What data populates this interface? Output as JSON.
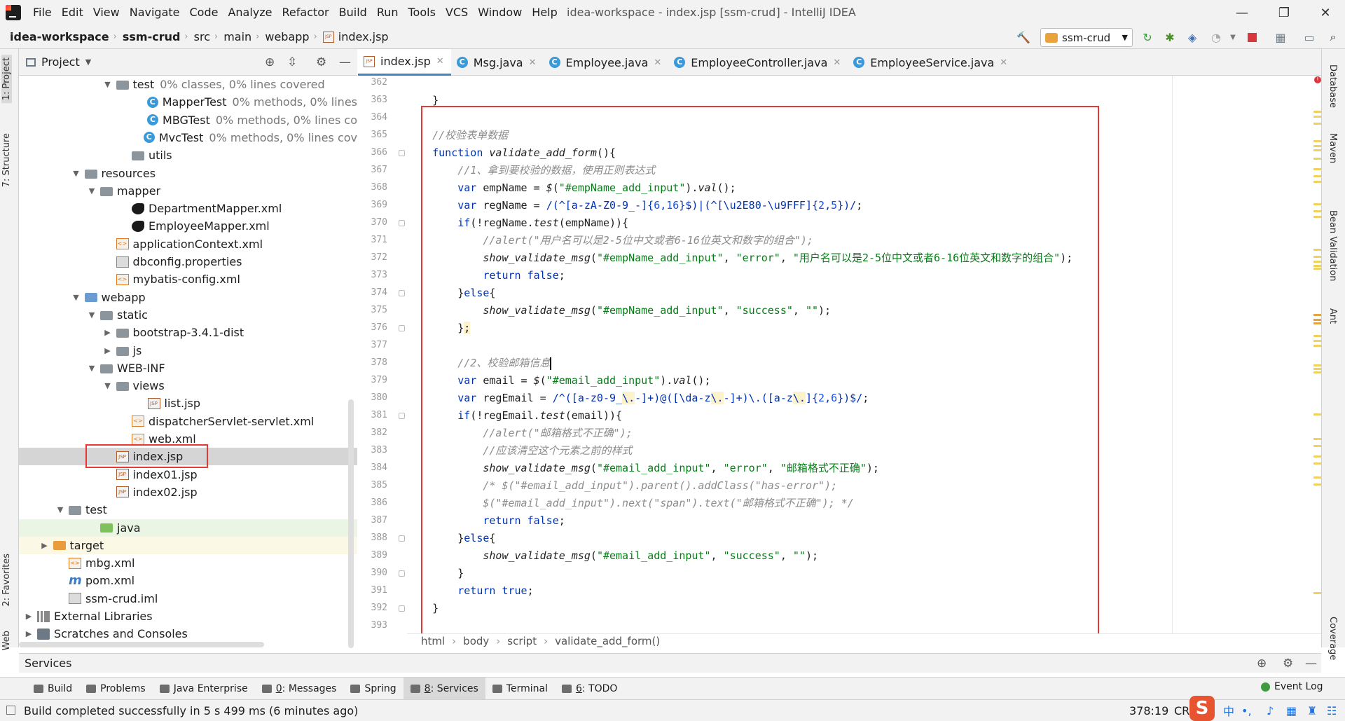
{
  "menu": [
    "File",
    "Edit",
    "View",
    "Navigate",
    "Code",
    "Analyze",
    "Refactor",
    "Build",
    "Run",
    "Tools",
    "VCS",
    "Window",
    "Help"
  ],
  "window_title": "idea-workspace - index.jsp [ssm-crud] - IntelliJ IDEA",
  "breadcrumb": [
    "idea-workspace",
    "ssm-crud",
    "src",
    "main",
    "webapp",
    "index.jsp"
  ],
  "run_config": "ssm-crud",
  "left_tabs": [
    "1: Project",
    "7: Structure",
    "2: Favorites",
    "Web"
  ],
  "right_tabs": [
    "Database",
    "Maven",
    "Bean Validation",
    "Ant",
    "Coverage"
  ],
  "project_panel": {
    "title": "Project"
  },
  "tree": [
    {
      "indent": 5,
      "arrow": "▼",
      "icon": "folder",
      "label": "test",
      "note": "0% classes, 0% lines covered"
    },
    {
      "indent": 7,
      "arrow": "",
      "icon": "cls",
      "label": "MapperTest",
      "note": "0% methods, 0% lines"
    },
    {
      "indent": 7,
      "arrow": "",
      "icon": "cls",
      "label": "MBGTest",
      "note": "0% methods, 0% lines co"
    },
    {
      "indent": 7,
      "arrow": "",
      "icon": "cls",
      "label": "MvcTest",
      "note": "0% methods, 0% lines cov"
    },
    {
      "indent": 6,
      "arrow": "",
      "icon": "folder",
      "label": "utils",
      "note": ""
    },
    {
      "indent": 3,
      "arrow": "▼",
      "icon": "folder",
      "label": "resources",
      "note": ""
    },
    {
      "indent": 4,
      "arrow": "▼",
      "icon": "folder",
      "label": "mapper",
      "note": ""
    },
    {
      "indent": 6,
      "arrow": "",
      "icon": "bird",
      "label": "DepartmentMapper.xml",
      "note": ""
    },
    {
      "indent": 6,
      "arrow": "",
      "icon": "bird",
      "label": "EmployeeMapper.xml",
      "note": ""
    },
    {
      "indent": 5,
      "arrow": "",
      "icon": "xml",
      "label": "applicationContext.xml",
      "note": ""
    },
    {
      "indent": 5,
      "arrow": "",
      "icon": "props",
      "label": "dbconfig.properties",
      "note": ""
    },
    {
      "indent": 5,
      "arrow": "",
      "icon": "xml",
      "label": "mybatis-config.xml",
      "note": ""
    },
    {
      "indent": 3,
      "arrow": "▼",
      "icon": "folder-blue",
      "label": "webapp",
      "note": ""
    },
    {
      "indent": 4,
      "arrow": "▼",
      "icon": "folder",
      "label": "static",
      "note": ""
    },
    {
      "indent": 5,
      "arrow": "▶",
      "icon": "folder",
      "label": "bootstrap-3.4.1-dist",
      "note": ""
    },
    {
      "indent": 5,
      "arrow": "▶",
      "icon": "folder",
      "label": "js",
      "note": ""
    },
    {
      "indent": 4,
      "arrow": "▼",
      "icon": "folder",
      "label": "WEB-INF",
      "note": ""
    },
    {
      "indent": 5,
      "arrow": "▼",
      "icon": "folder",
      "label": "views",
      "note": ""
    },
    {
      "indent": 7,
      "arrow": "",
      "icon": "jsp",
      "label": "list.jsp",
      "note": ""
    },
    {
      "indent": 6,
      "arrow": "",
      "icon": "xml",
      "label": "dispatcherServlet-servlet.xml",
      "note": ""
    },
    {
      "indent": 6,
      "arrow": "",
      "icon": "xml",
      "label": "web.xml",
      "note": ""
    },
    {
      "indent": 5,
      "arrow": "",
      "icon": "jsp",
      "label": "index.jsp",
      "note": "",
      "selected": true
    },
    {
      "indent": 5,
      "arrow": "",
      "icon": "jsp",
      "label": "index01.jsp",
      "note": ""
    },
    {
      "indent": 5,
      "arrow": "",
      "icon": "jsp",
      "label": "index02.jsp",
      "note": ""
    },
    {
      "indent": 2,
      "arrow": "▼",
      "icon": "folder",
      "label": "test",
      "note": ""
    },
    {
      "indent": 4,
      "arrow": "",
      "icon": "folder-green",
      "label": "java",
      "note": "",
      "green": true
    },
    {
      "indent": 1,
      "arrow": "▶",
      "icon": "folder-orange",
      "label": "target",
      "note": "",
      "yellow": true
    },
    {
      "indent": 2,
      "arrow": "",
      "icon": "xml",
      "label": "mbg.xml",
      "note": ""
    },
    {
      "indent": 2,
      "arrow": "",
      "icon": "maven",
      "label": "pom.xml",
      "note": ""
    },
    {
      "indent": 2,
      "arrow": "",
      "icon": "props",
      "label": "ssm-crud.iml",
      "note": ""
    },
    {
      "indent": 0,
      "arrow": "▶",
      "icon": "lib",
      "label": "External Libraries",
      "note": ""
    },
    {
      "indent": 0,
      "arrow": "▶",
      "icon": "scratch",
      "label": "Scratches and Consoles",
      "note": ""
    }
  ],
  "editor_tabs": [
    {
      "label": "index.jsp",
      "icon": "jsp",
      "active": true
    },
    {
      "label": "Msg.java",
      "icon": "cls",
      "active": false
    },
    {
      "label": "Employee.java",
      "icon": "cls",
      "active": false
    },
    {
      "label": "EmployeeController.java",
      "icon": "cls",
      "active": false
    },
    {
      "label": "EmployeeService.java",
      "icon": "cls",
      "active": false
    }
  ],
  "code_lines": [
    {
      "n": "362",
      "html": ""
    },
    {
      "n": "363",
      "html": "    }"
    },
    {
      "n": "364",
      "html": ""
    },
    {
      "n": "365",
      "html": "    <span class=\"cmt\">//校验表单数据</span>"
    },
    {
      "n": "366",
      "html": "    <span class=\"kw\">function</span> <span class=\"fn\">validate_add_form</span>(){"
    },
    {
      "n": "367",
      "html": "        <span class=\"cmt\">//1、拿到要校验的数据，使用正则表达式</span>"
    },
    {
      "n": "368",
      "html": "        <span class=\"kw\">var</span> empName = <span class=\"fn\">$</span>(<span class=\"str\">\"#empName_add_input\"</span>).<span class=\"fn\">val</span>();"
    },
    {
      "n": "369",
      "html": "        <span class=\"kw\">var</span> regName = <span class=\"rx\">/(^[a-zA-Z0-9_-]{<span class=\"num\">6</span>,<span class=\"num\">16</span>}$)|(^[\\u2E80-\\u9FFF]{<span class=\"num\">2</span>,<span class=\"num\">5</span>})/</span>;"
    },
    {
      "n": "370",
      "html": "        <span class=\"kw\">if</span>(!regName.<span class=\"fn\">test</span>(empName)){"
    },
    {
      "n": "371",
      "html": "            <span class=\"cmt\">//alert(\"用户名可以是2-5位中文或者6-16位英文和数字的组合\");</span>"
    },
    {
      "n": "372",
      "html": "            <span class=\"fn\">show_validate_msg</span>(<span class=\"str\">\"#empName_add_input\"</span>, <span class=\"str\">\"error\"</span>, <span class=\"str\">\"用户名可以是2-5位中文或者6-16位英文和数字的组合\"</span>);"
    },
    {
      "n": "373",
      "html": "            <span class=\"kw\">return false</span>;"
    },
    {
      "n": "374",
      "html": "        }<span class=\"kw\">else</span>{"
    },
    {
      "n": "375",
      "html": "            <span class=\"fn\">show_validate_msg</span>(<span class=\"str\">\"#empName_add_input\"</span>, <span class=\"str\">\"success\"</span>, <span class=\"str\">\"\"</span>);"
    },
    {
      "n": "376",
      "html": "        }<span class=\"hl\">;</span>"
    },
    {
      "n": "377",
      "html": ""
    },
    {
      "n": "378",
      "html": "        <span class=\"cmt\">//2、校验邮箱信息</span><span class=\"caret\"></span>"
    },
    {
      "n": "379",
      "html": "        <span class=\"kw\">var</span> email = <span class=\"fn\">$</span>(<span class=\"str\">\"#email_add_input\"</span>).<span class=\"fn\">val</span>();"
    },
    {
      "n": "380",
      "html": "        <span class=\"kw\">var</span> regEmail = <span class=\"rx\">/^([a-z0-9_<span class=\"hl\">\\.</span>-]+)@([\\da-z<span class=\"hl\">\\.</span>-]+)\\.([a-z<span class=\"hl\">\\.</span>]{<span class=\"num\">2</span>,<span class=\"num\">6</span>})$/</span>;"
    },
    {
      "n": "381",
      "html": "        <span class=\"kw\">if</span>(!regEmail.<span class=\"fn\">test</span>(email)){"
    },
    {
      "n": "382",
      "html": "            <span class=\"cmt\">//alert(\"邮箱格式不正确\");</span>"
    },
    {
      "n": "383",
      "html": "            <span class=\"cmt\">//应该清空这个元素之前的样式</span>"
    },
    {
      "n": "384",
      "html": "            <span class=\"fn\">show_validate_msg</span>(<span class=\"str\">\"#email_add_input\"</span>, <span class=\"str\">\"error\"</span>, <span class=\"str\">\"邮箱格式不正确\"</span>);"
    },
    {
      "n": "385",
      "html": "            <span class=\"cmt\">/* $(\"#email_add_input\").parent().addClass(\"has-error\");</span>"
    },
    {
      "n": "386",
      "html": "            <span class=\"cmt\">$(\"#email_add_input\").next(\"span\").text(\"邮箱格式不正确\"); */</span>"
    },
    {
      "n": "387",
      "html": "            <span class=\"kw\">return false</span>;"
    },
    {
      "n": "388",
      "html": "        }<span class=\"kw\">else</span>{"
    },
    {
      "n": "389",
      "html": "            <span class=\"fn\">show_validate_msg</span>(<span class=\"str\">\"#email_add_input\"</span>, <span class=\"str\">\"success\"</span>, <span class=\"str\">\"\"</span>);"
    },
    {
      "n": "390",
      "html": "        }"
    },
    {
      "n": "391",
      "html": "        <span class=\"kw\">return true</span>;"
    },
    {
      "n": "392",
      "html": "    }"
    },
    {
      "n": "393",
      "html": ""
    }
  ],
  "editor_breadcrumb": [
    "html",
    "body",
    "script",
    "validate_add_form()"
  ],
  "services": {
    "title": "Services"
  },
  "tool_windows": [
    {
      "label": "Build",
      "key": "",
      "active": false
    },
    {
      "label": "Problems",
      "key": "",
      "active": false
    },
    {
      "label": "Java Enterprise",
      "key": "",
      "active": false
    },
    {
      "label": ": Messages",
      "key": "0",
      "active": false
    },
    {
      "label": "Spring",
      "key": "",
      "active": false
    },
    {
      "label": ": Services",
      "key": "8",
      "active": true
    },
    {
      "label": "Terminal",
      "key": "",
      "active": false
    },
    {
      "label": ": TODO",
      "key": "6",
      "active": false
    }
  ],
  "event_log": "Event Log",
  "status": {
    "message": "Build completed successfully in 5 s 499 ms (6 minutes ago)",
    "position": "378:19",
    "line_sep": "CRL",
    "ime": "中"
  },
  "colors": {
    "accent": "#4083c9",
    "annotation": "#e53935",
    "keyword": "#0033b3",
    "string": "#067d17",
    "comment": "#8c8c8c"
  }
}
